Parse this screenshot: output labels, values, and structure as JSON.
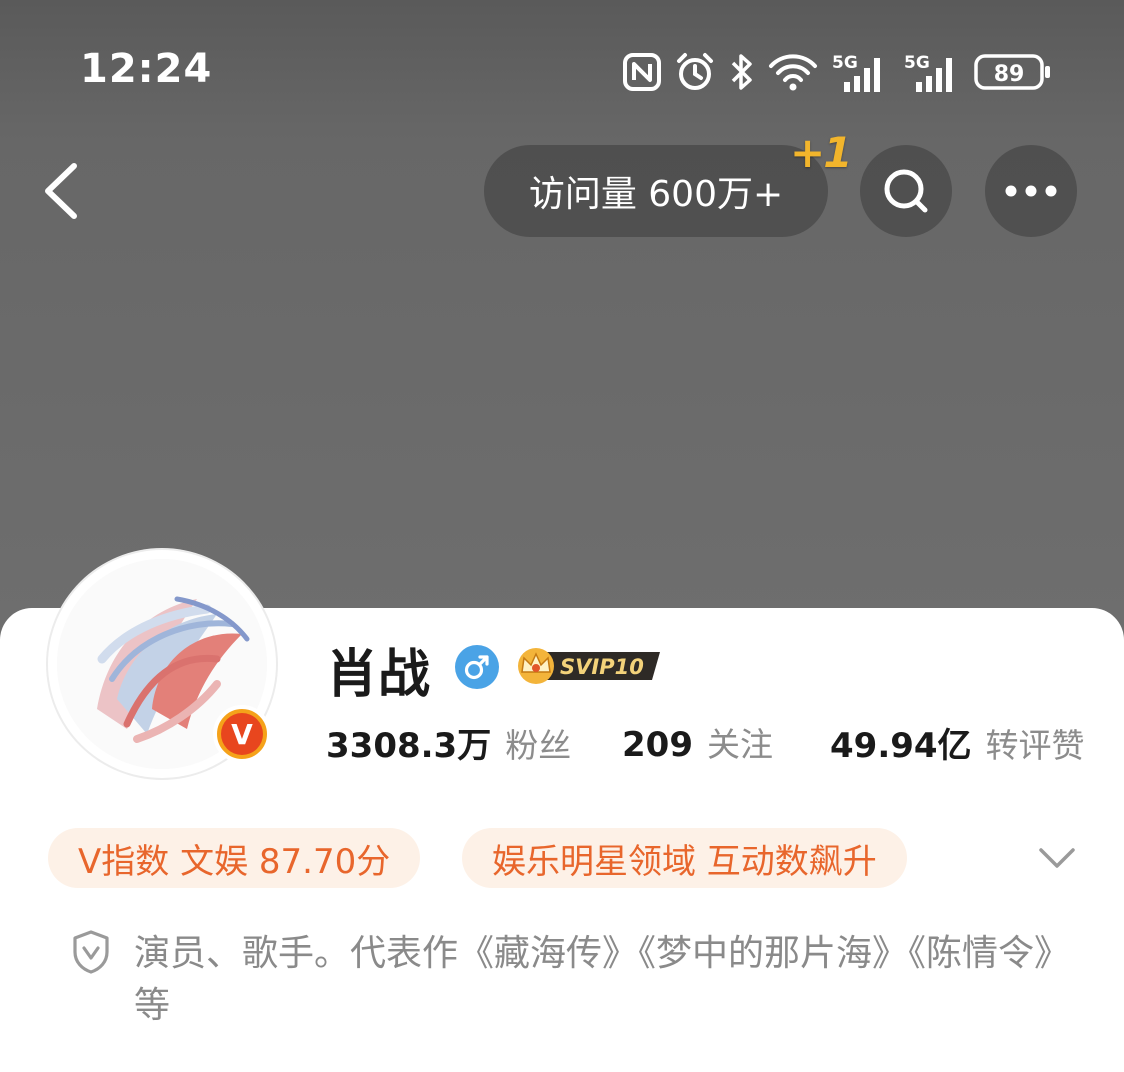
{
  "status_bar": {
    "time": "12:24",
    "icons": [
      "nfc-icon",
      "alarm-icon",
      "bluetooth-icon",
      "wifi-icon",
      "signal-5g-icon",
      "signal-5g-icon"
    ],
    "signal_label": "5G",
    "battery": "89"
  },
  "nav": {
    "visits_label": "访问量 600万+",
    "plus_one": "+1",
    "back_icon": "back-arrow-icon",
    "search_icon": "search-icon",
    "more_icon": "more-icon"
  },
  "profile": {
    "name": "肖战",
    "verified_badge": "V",
    "vip_label": "SVIP10",
    "gender_icon": "male-icon",
    "stats": [
      {
        "value": "3308.3万",
        "label": "粉丝"
      },
      {
        "value": "209",
        "label": "关注"
      },
      {
        "value": "49.94亿",
        "label": "转评赞"
      }
    ],
    "tags": [
      {
        "label": "V指数 文娱 87.70分"
      },
      {
        "label": "娱乐明星领域 互动数飙升"
      }
    ],
    "bio": "演员、歌手。代表作《藏海传》《梦中的那片海》《陈情令》等"
  },
  "colors": {
    "header_bg": "#6b6b6b",
    "tag_bg": "#fdf1e7",
    "tag_text": "#e8662c",
    "accent_gold": "#f2b52c",
    "gender_blue": "#4aa3e6"
  }
}
